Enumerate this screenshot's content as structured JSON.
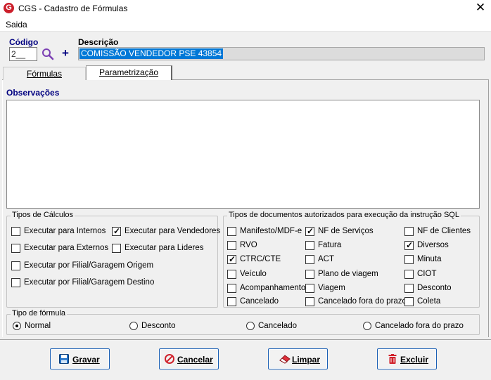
{
  "window": {
    "title": "CGS - Cadastro de Fórmulas",
    "app_icon_letter": "G",
    "close_glyph": "✕"
  },
  "menu": {
    "items": [
      "Saida"
    ]
  },
  "header": {
    "codigo_label": "Código",
    "codigo_value": "2__",
    "add_glyph": "+",
    "descricao_label": "Descrição",
    "descricao_value": "COMISSÃO VENDEDOR PSE 43854"
  },
  "tabs": [
    {
      "label": "Fórmulas",
      "active": false
    },
    {
      "label": "Parametrização",
      "active": true
    }
  ],
  "observacoes": {
    "label": "Observações",
    "value": ""
  },
  "tipos_calculos": {
    "legend": "Tipos de Cálculos",
    "options": [
      {
        "label": "Executar para Internos",
        "checked": false
      },
      {
        "label": "Executar para Vendedores",
        "checked": true
      },
      {
        "label": "Executar para Externos",
        "checked": false
      },
      {
        "label": "Executar para Lideres",
        "checked": false
      },
      {
        "label": "Executar por Filial/Garagem Origem",
        "checked": false
      },
      {
        "label": "Executar por Filial/Garagem Destino",
        "checked": false
      }
    ]
  },
  "tipos_documentos": {
    "legend": "Tipos de documentos autorizados para execução da instrução SQL",
    "options": [
      {
        "label": "Manifesto/MDF-e",
        "checked": false
      },
      {
        "label": "NF de Serviços",
        "checked": true
      },
      {
        "label": "NF de Clientes",
        "checked": false
      },
      {
        "label": "RVO",
        "checked": false
      },
      {
        "label": "Fatura",
        "checked": false
      },
      {
        "label": "Diversos",
        "checked": true
      },
      {
        "label": "CTRC/CTE",
        "checked": true
      },
      {
        "label": "ACT",
        "checked": false
      },
      {
        "label": "Minuta",
        "checked": false
      },
      {
        "label": "Veículo",
        "checked": false
      },
      {
        "label": "Plano de viagem",
        "checked": false
      },
      {
        "label": "CIOT",
        "checked": false
      },
      {
        "label": "Acompanhamento",
        "checked": false
      },
      {
        "label": "Viagem",
        "checked": false
      },
      {
        "label": "Desconto",
        "checked": false
      },
      {
        "label": "Cancelado",
        "checked": false
      },
      {
        "label": "Cancelado fora do prazo",
        "checked": false
      },
      {
        "label": "Coleta",
        "checked": false
      }
    ]
  },
  "tipo_formula": {
    "legend": "Tipo de fórmula",
    "options": [
      {
        "label": "Normal",
        "selected": true
      },
      {
        "label": "Desconto",
        "selected": false
      },
      {
        "label": "Cancelado",
        "selected": false
      },
      {
        "label": "Cancelado fora do prazo",
        "selected": false
      }
    ]
  },
  "buttons": [
    {
      "label": "Gravar",
      "icon": "save-icon"
    },
    {
      "label": "Cancelar",
      "icon": "cancel-icon"
    },
    {
      "label": "Limpar",
      "icon": "eraser-icon"
    },
    {
      "label": "Excluir",
      "icon": "trash-icon"
    }
  ]
}
